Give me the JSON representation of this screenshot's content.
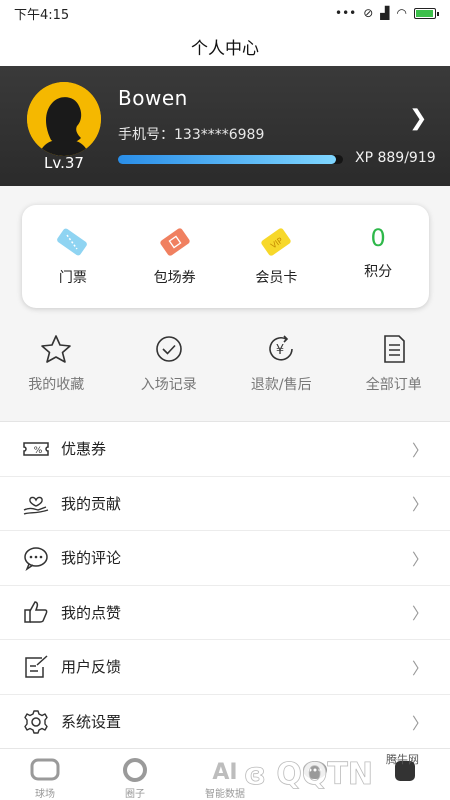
{
  "status_bar": {
    "time": "下午4:15"
  },
  "header": {
    "title": "个人中心"
  },
  "profile": {
    "username": "Bowen",
    "phone": "手机号：133****6989",
    "level": "Lv.37",
    "xp_text": "XP 889/919",
    "xp_progress": 0.967
  },
  "assets": {
    "tickets": "门票",
    "venue_vouchers": "包场券",
    "membership_card": "会员卡",
    "points_value": "0",
    "points_label": "积分"
  },
  "orders": {
    "favorites": "我的收藏",
    "entry_records": "入场记录",
    "refund": "退款/售后",
    "all_orders": "全部订单"
  },
  "menu": {
    "coupons": "优惠券",
    "contributions": "我的贡献",
    "comments": "我的评论",
    "likes": "我的点赞",
    "feedback": "用户反馈",
    "settings": "系统设置"
  },
  "tabs": {
    "courts": "球场",
    "circle": "圈子",
    "smart_data": "智能数据"
  },
  "watermark": {
    "text": "腾牛网"
  },
  "colors": {
    "points": "#2eb84a",
    "xp_bar": "#3aa8f0",
    "avatar_bg": "#f5b800"
  }
}
